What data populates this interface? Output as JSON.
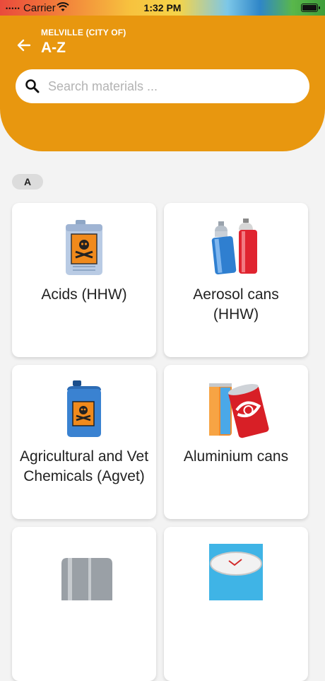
{
  "status_bar": {
    "carrier": "Carrier",
    "time": "1:32 PM"
  },
  "header": {
    "subtitle": "MELVILLE (CITY OF)",
    "title": "A-Z"
  },
  "search": {
    "placeholder": "Search materials ..."
  },
  "section": {
    "letter": "A"
  },
  "materials": [
    {
      "label": "Acids (HHW)",
      "icon": "acid-container-icon"
    },
    {
      "label": "Aerosol cans (HHW)",
      "icon": "aerosol-cans-icon"
    },
    {
      "label": "Agricultural and Vet Chemicals (Agvet)",
      "icon": "chemical-drum-icon"
    },
    {
      "label": "Aluminium cans",
      "icon": "aluminium-cans-icon"
    },
    {
      "label": "",
      "icon": "aluminium-foil-icon"
    },
    {
      "label": "",
      "icon": "aluminium-tray-icon"
    }
  ]
}
